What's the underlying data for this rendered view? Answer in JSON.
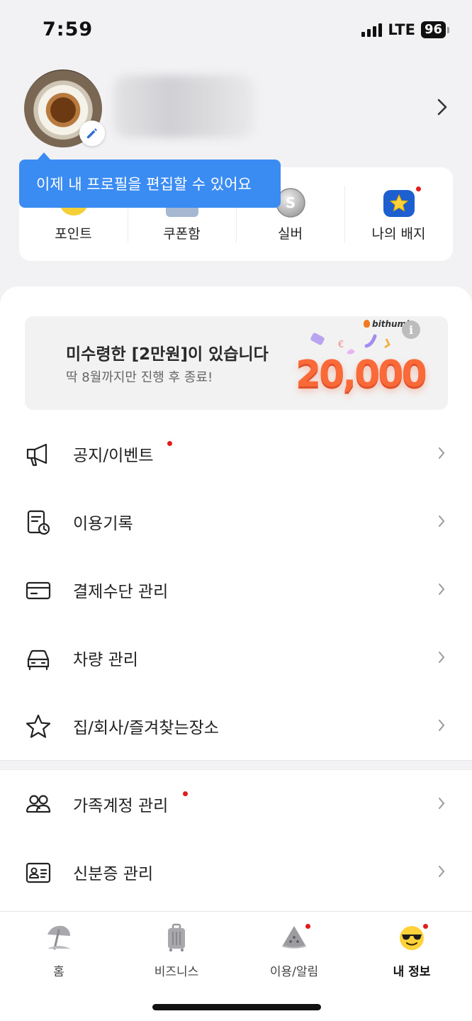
{
  "status": {
    "time": "7:59",
    "network": "LTE",
    "battery": "96"
  },
  "profile": {
    "tooltip": "이제 내 프로필을 편집할 수 있어요"
  },
  "quick_menu": [
    {
      "label": "포인트",
      "icon": "point-coin-icon",
      "new": false
    },
    {
      "label": "쿠폰함",
      "icon": "coupon-box-icon",
      "new": false
    },
    {
      "label": "실버",
      "icon": "silver-coin-icon",
      "new": false
    },
    {
      "label": "나의 배지",
      "icon": "star-badge-icon",
      "new": true
    }
  ],
  "banner": {
    "title": "미수령한 [2만원]이 있습니다",
    "subtitle": "딱 8월까지만 진행 후 종료!",
    "brand": "bithumb",
    "amount": "20,000"
  },
  "menu_group_1": [
    {
      "label": "공지/이벤트",
      "icon": "megaphone-icon",
      "new": true
    },
    {
      "label": "이용기록",
      "icon": "usage-history-icon",
      "new": false
    },
    {
      "label": "결제수단 관리",
      "icon": "credit-card-icon",
      "new": false
    },
    {
      "label": "차량 관리",
      "icon": "car-icon",
      "new": false
    },
    {
      "label": "집/회사/즐겨찾는장소",
      "icon": "star-outline-icon",
      "new": false
    }
  ],
  "menu_group_2": [
    {
      "label": "가족계정 관리",
      "icon": "family-icon",
      "new": true
    },
    {
      "label": "신분증 관리",
      "icon": "id-card-icon",
      "new": false
    }
  ],
  "tabs": [
    {
      "label": "홈",
      "icon": "beach-umbrella-icon",
      "active": false,
      "new": false
    },
    {
      "label": "비즈니스",
      "icon": "suitcase-icon",
      "active": false,
      "new": false
    },
    {
      "label": "이용/알림",
      "icon": "watermelon-icon",
      "active": false,
      "new": true
    },
    {
      "label": "내 정보",
      "icon": "sunglasses-emoji-icon",
      "active": true,
      "new": true
    }
  ],
  "colors": {
    "accent": "#3a8bf2",
    "badge_red": "#e21c1c",
    "amount_orange": "#f96a38"
  }
}
